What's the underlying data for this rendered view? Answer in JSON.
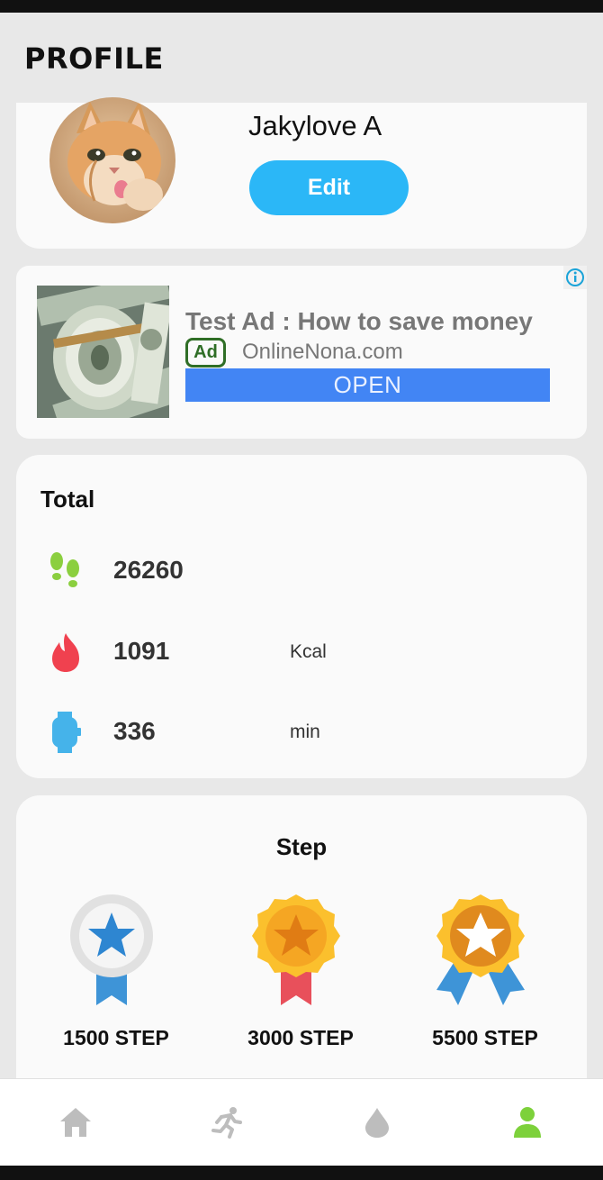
{
  "header": {
    "title": "PROFILE"
  },
  "profile": {
    "name": "Jakylove A",
    "edit_label": "Edit"
  },
  "ad": {
    "title": "Test Ad : How to save money",
    "badge": "Ad",
    "domain": "OnlineNona.com",
    "cta": "OPEN"
  },
  "total": {
    "title": "Total",
    "rows": [
      {
        "icon": "footprints-icon",
        "value": "26260",
        "unit": ""
      },
      {
        "icon": "flame-icon",
        "value": "1091",
        "unit": "Kcal"
      },
      {
        "icon": "watch-icon",
        "value": "336",
        "unit": "min"
      }
    ]
  },
  "step": {
    "title": "Step",
    "badges": [
      {
        "label": "1500 STEP",
        "tier": "silver"
      },
      {
        "label": "3000 STEP",
        "tier": "gold"
      },
      {
        "label": "5500 STEP",
        "tier": "gold-ribbon"
      }
    ]
  },
  "nav": {
    "items": [
      {
        "icon": "home-icon",
        "active": false
      },
      {
        "icon": "running-icon",
        "active": false
      },
      {
        "icon": "water-drop-icon",
        "active": false
      },
      {
        "icon": "person-icon",
        "active": true
      }
    ]
  },
  "colors": {
    "accent": "#2bb7f7",
    "active_nav": "#7dd13b",
    "inactive_nav": "#bdbdbd",
    "ad_button": "#4285f4"
  }
}
